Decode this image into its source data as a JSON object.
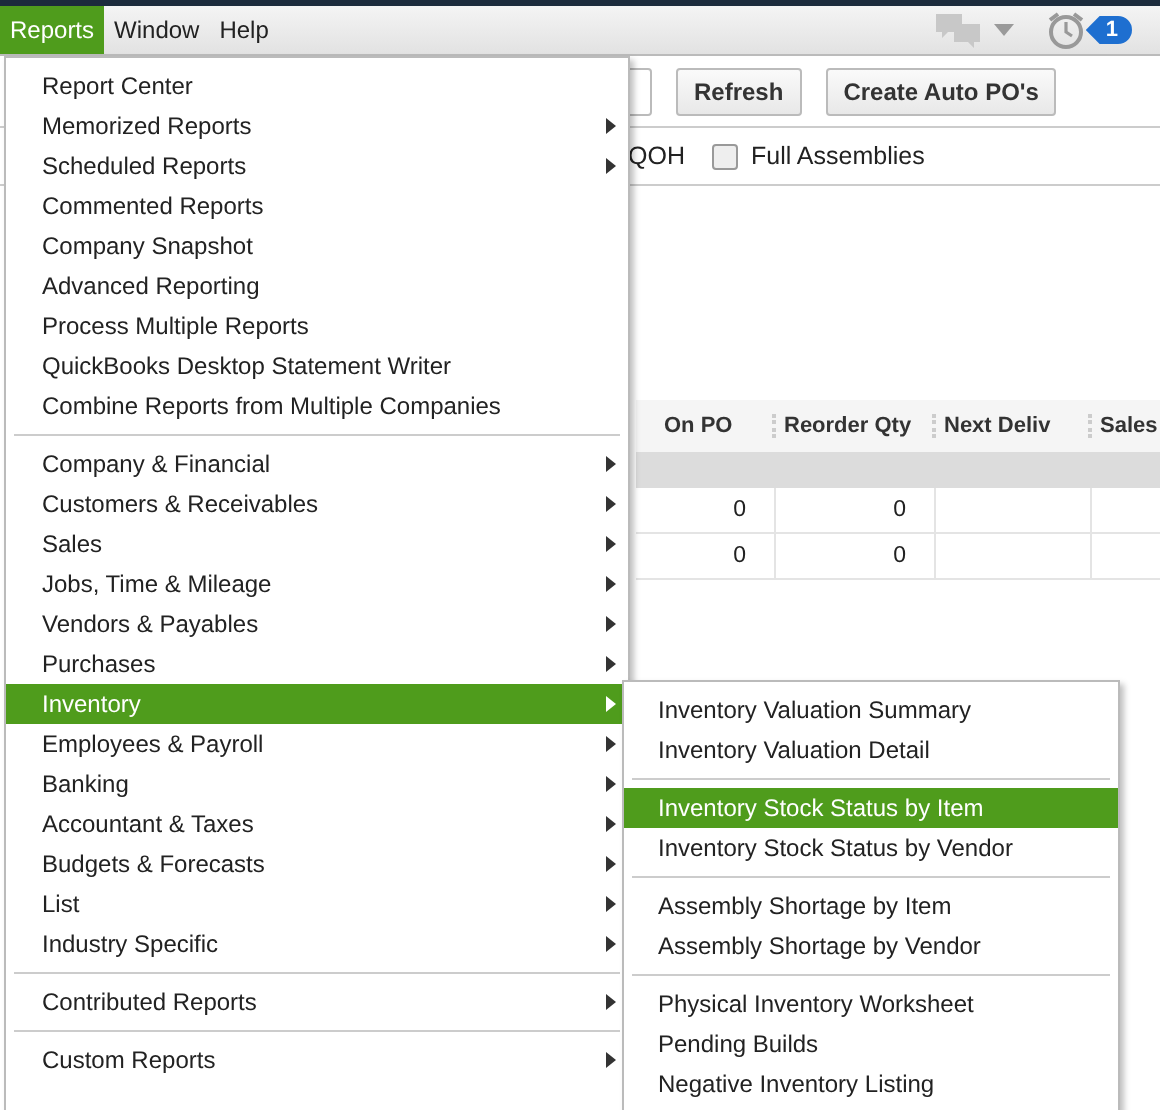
{
  "menubar": [
    {
      "label": "Reports",
      "selected": true
    },
    {
      "label": "Window",
      "selected": false
    },
    {
      "label": "Help",
      "selected": false
    }
  ],
  "notification_badge": "1",
  "toolbar": {
    "buttons": [
      "Refresh",
      "Create Auto PO's"
    ]
  },
  "filters": {
    "qoh_label": "QOH",
    "full_assemblies": {
      "label": "Full Assemblies",
      "checked": false
    }
  },
  "table": {
    "columns": [
      "On PO",
      "Reorder Qty",
      "Next Deliv",
      "Sales"
    ],
    "rows": [
      [
        "0",
        "0"
      ],
      [
        "0",
        "0"
      ]
    ]
  },
  "reports_menu": [
    [
      {
        "label": "Report Center",
        "submenu": false,
        "selected": false
      },
      {
        "label": "Memorized Reports",
        "submenu": true,
        "selected": false
      },
      {
        "label": "Scheduled Reports",
        "submenu": true,
        "selected": false
      },
      {
        "label": "Commented Reports",
        "submenu": false,
        "selected": false
      },
      {
        "label": "Company Snapshot",
        "submenu": false,
        "selected": false
      },
      {
        "label": "Advanced Reporting",
        "submenu": false,
        "selected": false
      },
      {
        "label": "Process Multiple Reports",
        "submenu": false,
        "selected": false
      },
      {
        "label": "QuickBooks Desktop Statement Writer",
        "submenu": false,
        "selected": false
      },
      {
        "label": "Combine Reports from Multiple Companies",
        "submenu": false,
        "selected": false
      }
    ],
    [
      {
        "label": "Company & Financial",
        "submenu": true,
        "selected": false
      },
      {
        "label": "Customers & Receivables",
        "submenu": true,
        "selected": false
      },
      {
        "label": "Sales",
        "submenu": true,
        "selected": false
      },
      {
        "label": "Jobs, Time & Mileage",
        "submenu": true,
        "selected": false
      },
      {
        "label": "Vendors & Payables",
        "submenu": true,
        "selected": false
      },
      {
        "label": "Purchases",
        "submenu": true,
        "selected": false
      },
      {
        "label": "Inventory",
        "submenu": true,
        "selected": true
      },
      {
        "label": "Employees & Payroll",
        "submenu": true,
        "selected": false
      },
      {
        "label": "Banking",
        "submenu": true,
        "selected": false
      },
      {
        "label": "Accountant & Taxes",
        "submenu": true,
        "selected": false
      },
      {
        "label": "Budgets & Forecasts",
        "submenu": true,
        "selected": false
      },
      {
        "label": "List",
        "submenu": true,
        "selected": false
      },
      {
        "label": "Industry Specific",
        "submenu": true,
        "selected": false
      }
    ],
    [
      {
        "label": "Contributed Reports",
        "submenu": true,
        "selected": false
      }
    ],
    [
      {
        "label": "Custom Reports",
        "submenu": true,
        "selected": false
      }
    ]
  ],
  "inventory_submenu": [
    [
      {
        "label": "Inventory Valuation Summary",
        "selected": false
      },
      {
        "label": "Inventory Valuation Detail",
        "selected": false
      }
    ],
    [
      {
        "label": "Inventory Stock Status by Item",
        "selected": true
      },
      {
        "label": "Inventory Stock Status by Vendor",
        "selected": false
      }
    ],
    [
      {
        "label": "Assembly Shortage by Item",
        "selected": false
      },
      {
        "label": "Assembly Shortage by Vendor",
        "selected": false
      }
    ],
    [
      {
        "label": "Physical Inventory Worksheet",
        "selected": false
      },
      {
        "label": "Pending Builds",
        "selected": false
      },
      {
        "label": "Negative Inventory Listing",
        "selected": false
      }
    ]
  ]
}
